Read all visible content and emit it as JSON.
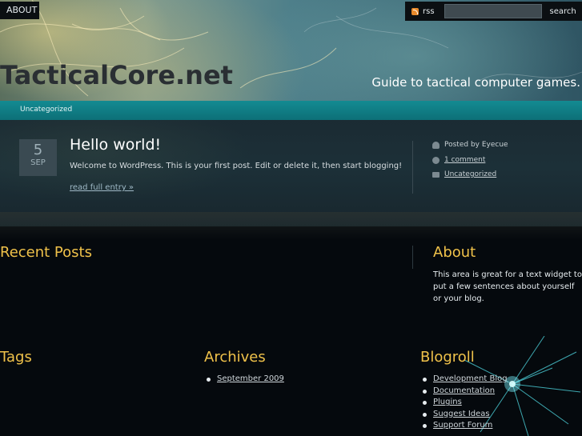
{
  "topbar": {
    "tab_label": "ABOUT",
    "rss_label": "rss",
    "search_placeholder": "",
    "search_button": "search"
  },
  "header": {
    "site_title": "TacticalCore.net",
    "tagline": "Guide to tactical computer games."
  },
  "nav": {
    "items": [
      "Uncategorized"
    ]
  },
  "post": {
    "date_day": "5",
    "date_month": "SEP",
    "title": "Hello world!",
    "excerpt": "Welcome to WordPress. This is your first post. Edit or delete it, then start blogging!",
    "read_more": "read full entry »",
    "meta": {
      "posted_by": "Posted by Eyecue",
      "comments": "1 comment",
      "category": "Uncategorized"
    }
  },
  "widgets": {
    "recent_posts": {
      "heading": "Recent Posts"
    },
    "about": {
      "heading": "About",
      "text": "This area is great for a text widget to put a few sentences about yourself or your blog."
    },
    "tags": {
      "heading": "Tags"
    },
    "archives": {
      "heading": "Archives",
      "items": [
        "September 2009"
      ]
    },
    "blogroll": {
      "heading": "Blogroll",
      "items": [
        "Development Blog",
        "Documentation",
        "Plugins",
        "Suggest Ideas",
        "Support Forum"
      ]
    }
  },
  "colors": {
    "accent_nav": "#138b92",
    "widget_heading": "#f0c24a",
    "background": "#05090d"
  }
}
